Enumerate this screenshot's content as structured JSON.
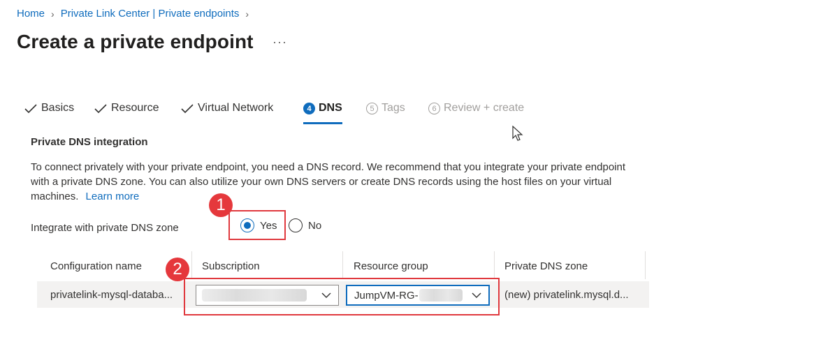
{
  "breadcrumb": {
    "items": [
      "Home",
      "Private Link Center | Private endpoints"
    ]
  },
  "page": {
    "title": "Create a private endpoint",
    "more": "···"
  },
  "tabs": [
    {
      "label": "Basics",
      "state": "done"
    },
    {
      "label": "Resource",
      "state": "done"
    },
    {
      "label": "Virtual Network",
      "state": "done"
    },
    {
      "label": "DNS",
      "number": "4",
      "state": "active"
    },
    {
      "label": "Tags",
      "number": "5",
      "state": "disabled"
    },
    {
      "label": "Review + create",
      "number": "6",
      "state": "disabled"
    }
  ],
  "dns": {
    "section_title": "Private DNS integration",
    "description": "To connect privately with your private endpoint, you need a DNS record. We recommend that you integrate your private endpoint with a private DNS zone. You can also utilize your own DNS servers or create DNS records using the host files on your virtual machines.",
    "learn_more": "Learn more",
    "integrate_label": "Integrate with private DNS zone",
    "options": {
      "yes": "Yes",
      "no": "No",
      "selected": "Yes"
    }
  },
  "table": {
    "headers": [
      "Configuration name",
      "Subscription",
      "Resource group",
      "Private DNS zone"
    ],
    "row": {
      "configuration_name": "privatelink-mysql-databa...",
      "subscription": "",
      "resource_group": "JumpVM-RG-",
      "private_dns_zone": "(new) privatelink.mysql.d..."
    }
  },
  "annotations": {
    "badge1": "1",
    "badge2": "2",
    "color": "#e5383c"
  },
  "colors": {
    "accent": "#0f6cbd",
    "text": "#323130",
    "disabled": "#a19f9d"
  }
}
